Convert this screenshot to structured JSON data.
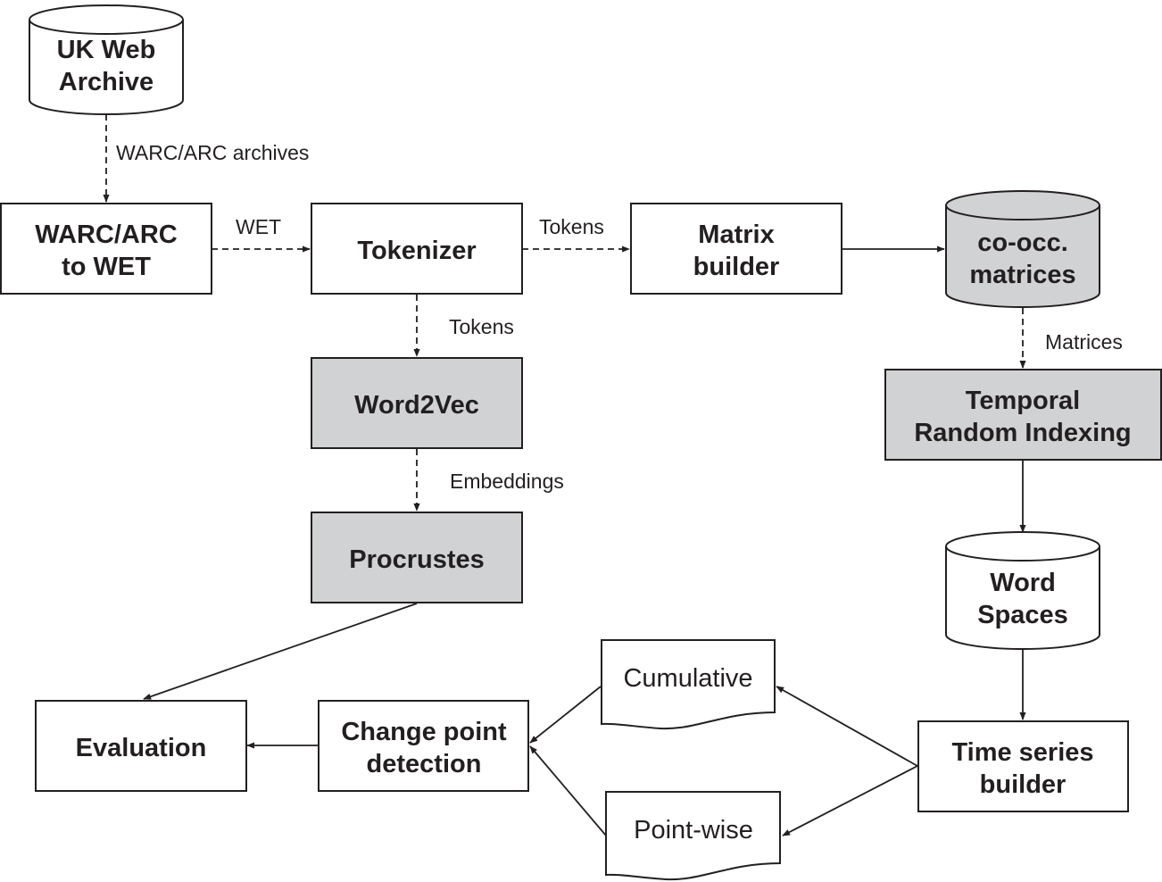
{
  "nodes": {
    "uk_web_archive": {
      "lines": [
        "UK Web",
        "Archive"
      ],
      "shape": "cylinder",
      "fill": "#ffffff"
    },
    "warc_to_wet": {
      "lines": [
        "WARC/ARC",
        "to WET"
      ],
      "shape": "rect",
      "fill": "#ffffff"
    },
    "tokenizer": {
      "lines": [
        "Tokenizer"
      ],
      "shape": "rect",
      "fill": "#ffffff"
    },
    "matrix_builder": {
      "lines": [
        "Matrix",
        "builder"
      ],
      "shape": "rect",
      "fill": "#ffffff"
    },
    "cooc_matrices": {
      "lines": [
        "co-occ.",
        "matrices"
      ],
      "shape": "cylinder",
      "fill": "#d1d2d4"
    },
    "word2vec": {
      "lines": [
        "Word2Vec"
      ],
      "shape": "rect",
      "fill": "#d1d2d4"
    },
    "temporal_ri": {
      "lines": [
        "Temporal",
        "Random Indexing"
      ],
      "shape": "rect",
      "fill": "#d1d2d4"
    },
    "procrustes": {
      "lines": [
        "Procrustes"
      ],
      "shape": "rect",
      "fill": "#d1d2d4"
    },
    "word_spaces": {
      "lines": [
        "Word",
        "Spaces"
      ],
      "shape": "cylinder",
      "fill": "#ffffff"
    },
    "cumulative": {
      "lines": [
        "Cumulative"
      ],
      "shape": "document",
      "fill": "#ffffff"
    },
    "pointwise": {
      "lines": [
        "Point-wise"
      ],
      "shape": "document",
      "fill": "#ffffff"
    },
    "evaluation": {
      "lines": [
        "Evaluation"
      ],
      "shape": "rect",
      "fill": "#ffffff"
    },
    "change_point": {
      "lines": [
        "Change point",
        "detection"
      ],
      "shape": "rect",
      "fill": "#ffffff"
    },
    "time_series": {
      "lines": [
        "Time series",
        "builder"
      ],
      "shape": "rect",
      "fill": "#ffffff"
    }
  },
  "edges": [
    {
      "from": "uk_web_archive",
      "to": "warc_to_wet",
      "label": "WARC/ARC archives",
      "style": "dashed"
    },
    {
      "from": "warc_to_wet",
      "to": "tokenizer",
      "label": "WET",
      "style": "dashed"
    },
    {
      "from": "tokenizer",
      "to": "matrix_builder",
      "label": "Tokens",
      "style": "dashed"
    },
    {
      "from": "matrix_builder",
      "to": "cooc_matrices",
      "label": "",
      "style": "solid"
    },
    {
      "from": "tokenizer",
      "to": "word2vec",
      "label": "Tokens",
      "style": "dashed"
    },
    {
      "from": "cooc_matrices",
      "to": "temporal_ri",
      "label": "Matrices",
      "style": "dashed"
    },
    {
      "from": "word2vec",
      "to": "procrustes",
      "label": "Embeddings",
      "style": "dashed"
    },
    {
      "from": "temporal_ri",
      "to": "word_spaces",
      "label": "",
      "style": "solid"
    },
    {
      "from": "word_spaces",
      "to": "time_series",
      "label": "",
      "style": "solid"
    },
    {
      "from": "procrustes",
      "to": "evaluation",
      "label": "",
      "style": "solid"
    },
    {
      "from": "change_point",
      "to": "evaluation",
      "label": "",
      "style": "solid"
    },
    {
      "from": "time_series",
      "to": "cumulative",
      "label": "",
      "style": "solid"
    },
    {
      "from": "time_series",
      "to": "pointwise",
      "label": "",
      "style": "solid"
    },
    {
      "from": "cumulative",
      "to": "change_point",
      "label": "",
      "style": "solid"
    },
    {
      "from": "pointwise",
      "to": "change_point",
      "label": "",
      "style": "solid"
    }
  ]
}
